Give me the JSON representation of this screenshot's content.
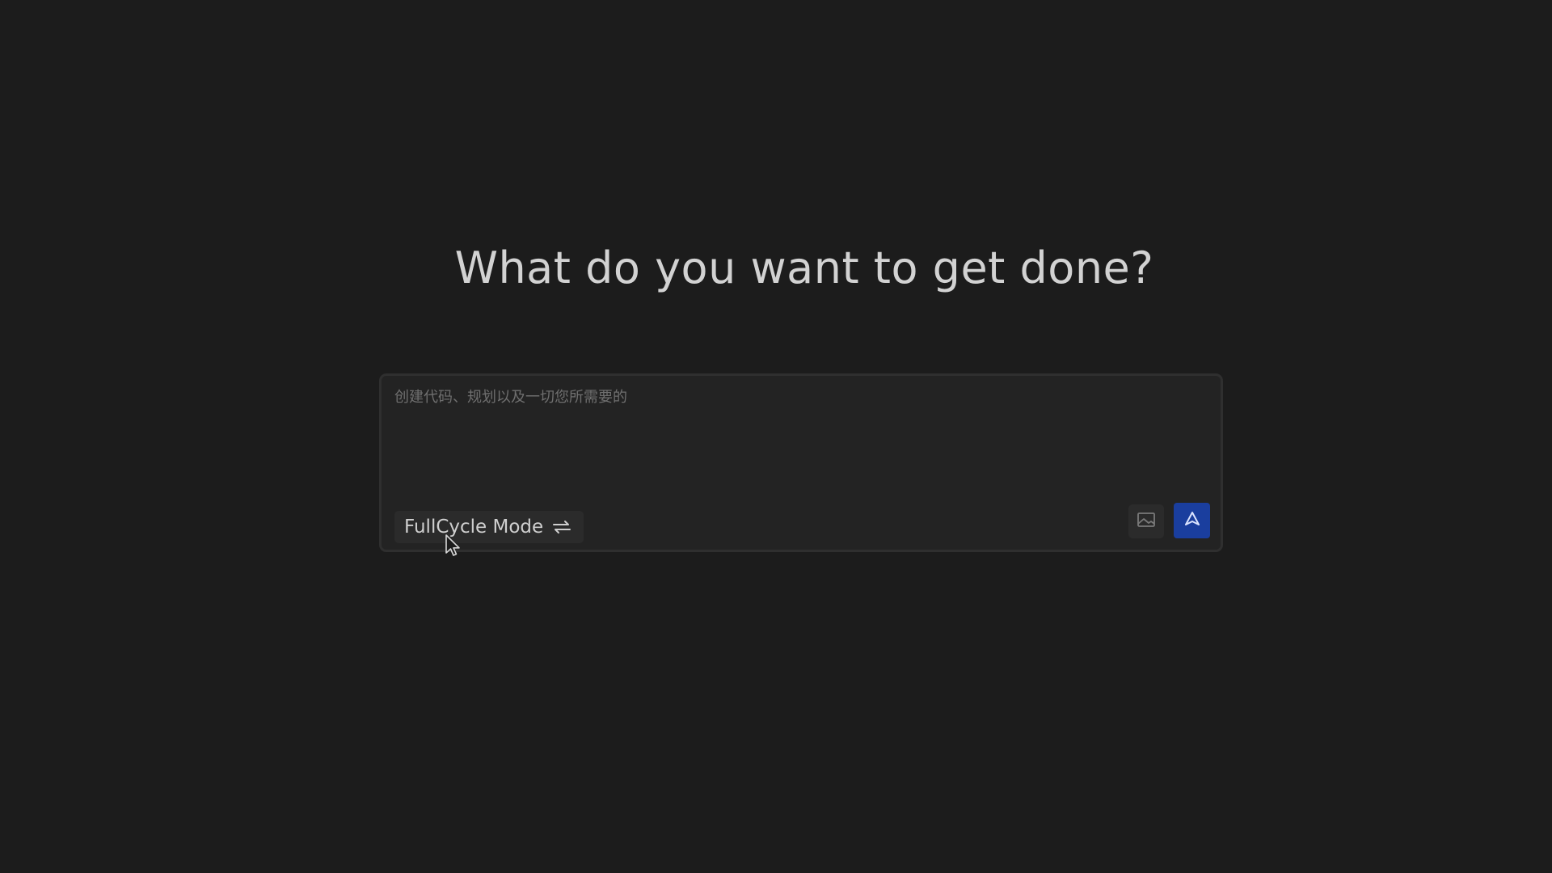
{
  "main": {
    "headline": "What do you want to get done?"
  },
  "composer": {
    "placeholder": "创建代码、规划以及一切您所需要的",
    "value": "",
    "mode_label": "FullCycle Mode",
    "mode_icon": "swap-arrows-icon",
    "image_icon": "image-icon",
    "send_icon": "send-arrow-icon"
  },
  "colors": {
    "background": "#1c1c1c",
    "card": "#232323",
    "accent": "#1a3e9e"
  }
}
